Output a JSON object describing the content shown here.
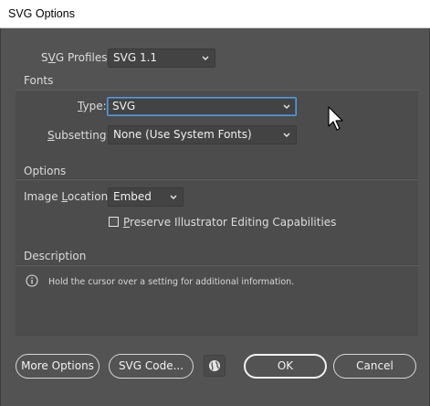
{
  "window": {
    "title": "SVG Options"
  },
  "profiles": {
    "label_pre": "S",
    "label_acc": "V",
    "label_post": "G Profiles:",
    "value": "SVG 1.1"
  },
  "fonts": {
    "section_label": "Fonts",
    "type_label_pre": "",
    "type_label_acc": "T",
    "type_label_post": "ype:",
    "type_value": "SVG",
    "subsetting_label_pre": "",
    "subsetting_label_acc": "S",
    "subsetting_label_post": "ubsetting:",
    "subsetting_value": "None (Use System Fonts)"
  },
  "options": {
    "section_label": "Options",
    "image_location_label_pre": "Image ",
    "image_location_label_acc": "L",
    "image_location_label_post": "ocation:",
    "image_location_value": "Embed",
    "preserve_label_acc": "P",
    "preserve_label_post": "reserve Illustrator Editing Capabilities",
    "preserve_checked": false
  },
  "description": {
    "section_label": "Description",
    "text": "Hold the cursor over a setting for additional information."
  },
  "buttons": {
    "more_options": "More Options",
    "svg_code": "SVG Code...",
    "ok": "OK",
    "cancel": "Cancel"
  },
  "colors": {
    "dialog_bg": "#535353",
    "group_bg": "#4c4c4c",
    "focus": "#5b9bd5"
  },
  "icons": {
    "caret": "chevron-down-icon",
    "info": "info-icon",
    "globe": "globe-icon",
    "cursor": "mouse-pointer-icon"
  }
}
